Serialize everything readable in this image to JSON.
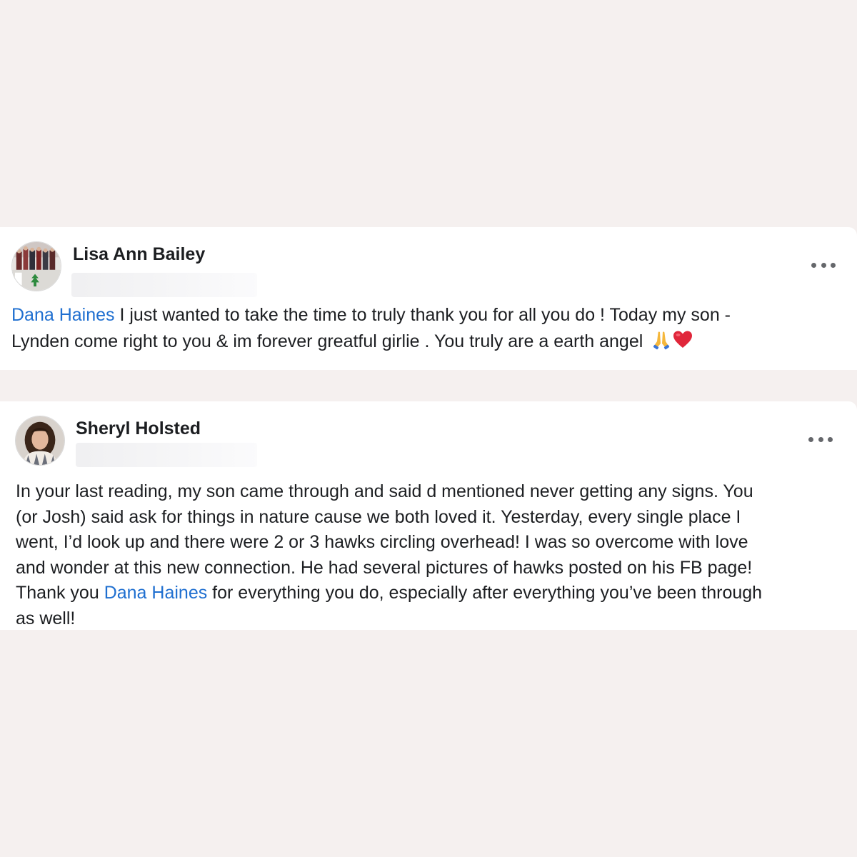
{
  "posts": [
    {
      "author": "Lisa Ann Bailey",
      "mention": "Dana Haines",
      "line1_rest": " I just wanted to take the time to truly thank you for all you do ! Today my son -",
      "line2": "Lynden come right to you & im forever greatful girlie . You truly are a earth angel ",
      "emojis": [
        "folded-hands-icon",
        "red-heart-icon"
      ]
    },
    {
      "author": "Sheryl Holsted",
      "lines": [
        "In your last reading, my son came through and said d mentioned never getting any signs. You",
        "(or Josh) said ask for things in nature cause we both loved it. Yesterday, every single place I",
        "went, I’d look up and there were 2 or 3 hawks circling overhead! I was so overcome with love",
        "and wonder at this new connection. He had several pictures of hawks posted on his FB page!"
      ],
      "line5_before": "Thank you ",
      "mention": "Dana Haines",
      "line5_after": " for everything you do, especially after everything you’ve been through",
      "line6": "as well!"
    }
  ],
  "colors": {
    "background": "#f5f0ef",
    "card": "#ffffff",
    "mention": "#1f6fd0",
    "text": "#1c1e21",
    "icon": "#65676b"
  },
  "icons": {
    "more": "more-options-icon"
  }
}
